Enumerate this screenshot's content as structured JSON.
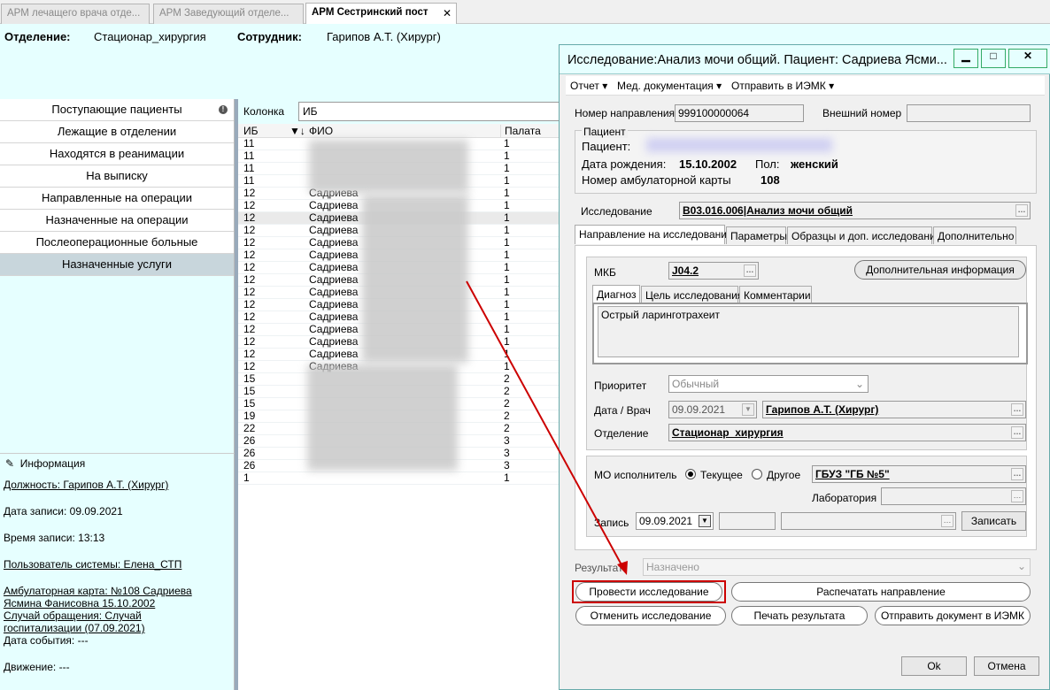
{
  "tabs": [
    {
      "label": "АРМ лечащего врача отде..."
    },
    {
      "label": "АРМ Заведующий отделе..."
    },
    {
      "label": "АРМ Сестринский пост",
      "close": "✕"
    }
  ],
  "header": {
    "dept_label": "Отделение:",
    "dept_value": "Стационар_хирургия",
    "emp_label": "Сотрудник:",
    "emp_value": "Гарипов А.Т. (Хирург)"
  },
  "nav": {
    "items": [
      {
        "label": "Поступающие пациенты"
      },
      {
        "label": "Лежащие в отделении"
      },
      {
        "label": "Находятся в реанимации"
      },
      {
        "label": "На выписку"
      },
      {
        "label": "Направленные на операции"
      },
      {
        "label": "Назначенные на операции"
      },
      {
        "label": "Послеоперационные больные"
      },
      {
        "label": "Назначенные услуги"
      }
    ],
    "info_badge": "!"
  },
  "info": {
    "title": "Информация",
    "position": "Должность: Гарипов А.Т. (Хирург)",
    "record_date": "Дата записи: 09.09.2021",
    "record_time": "Время записи: 13:13",
    "user": "Пользователь системы: Елена_СТП",
    "card_1": "Амбулаторная карта: №108 Садриева ",
    "card_2": "Ясмина Фанисовна 15.10.2002",
    "case_1": "Случай обращения: Случай ",
    "case_2": "госпитализации (07.09.2021)",
    "event_date": "Дата события: ---",
    "movement": "Движение: ---"
  },
  "filter": {
    "label": "Колонка",
    "value": "ИБ"
  },
  "table": {
    "headers": {
      "ib": "ИБ",
      "fio": "ФИО",
      "palata": "Палата"
    },
    "rows": [
      {
        "ib": "11",
        "fio": "",
        "palata": "1"
      },
      {
        "ib": "11",
        "fio": "",
        "palata": "1"
      },
      {
        "ib": "11",
        "fio": "",
        "palata": "1"
      },
      {
        "ib": "11",
        "fio": "",
        "palata": "1"
      },
      {
        "ib": "12",
        "fio": "Садриева",
        "palata": "1"
      },
      {
        "ib": "12",
        "fio": "Садриева",
        "palata": "1"
      },
      {
        "ib": "12",
        "fio": "Садриева",
        "palata": "1"
      },
      {
        "ib": "12",
        "fio": "Садриева",
        "palata": "1"
      },
      {
        "ib": "12",
        "fio": "Садриева",
        "palata": "1"
      },
      {
        "ib": "12",
        "fio": "Садриева",
        "palata": "1"
      },
      {
        "ib": "12",
        "fio": "Садриева",
        "palata": "1"
      },
      {
        "ib": "12",
        "fio": "Садриева",
        "palata": "1"
      },
      {
        "ib": "12",
        "fio": "Садриева",
        "palata": "1"
      },
      {
        "ib": "12",
        "fio": "Садриева",
        "palata": "1"
      },
      {
        "ib": "12",
        "fio": "Садриева",
        "palata": "1"
      },
      {
        "ib": "12",
        "fio": "Садриева",
        "palata": "1"
      },
      {
        "ib": "12",
        "fio": "Садриева",
        "palata": "1"
      },
      {
        "ib": "12",
        "fio": "Садриева",
        "palata": "1"
      },
      {
        "ib": "12",
        "fio": "Садриева",
        "palata": "1"
      },
      {
        "ib": "15",
        "fio": "",
        "palata": "2"
      },
      {
        "ib": "15",
        "fio": "",
        "palata": "2"
      },
      {
        "ib": "15",
        "fio": "",
        "palata": "2"
      },
      {
        "ib": "19",
        "fio": "",
        "palata": "2"
      },
      {
        "ib": "22",
        "fio": "",
        "palata": "2"
      },
      {
        "ib": "26",
        "fio": "",
        "palata": "3"
      },
      {
        "ib": "26",
        "fio": "",
        "palata": "3"
      },
      {
        "ib": "26",
        "fio": "",
        "palata": "3"
      },
      {
        "ib": "1",
        "fio": "",
        "palata": "1"
      }
    ]
  },
  "dialog": {
    "title": "Исследование:Анализ мочи общий. Пациент: Садриева Ясми...",
    "min": "▁",
    "max": "□",
    "close": "✕",
    "menu": {
      "report": "Отчет ▾",
      "docs": "Мед. документация ▾",
      "send": "Отправить в ИЭМК ▾"
    },
    "referral_label": "Номер направления",
    "referral_value": "999100000064",
    "external_label": "Внешний номер",
    "external_value": "",
    "patient_group": "Пациент",
    "patient_label": "Пациент:",
    "dob_label": "Дата рождения:",
    "dob_value": "15.10.2002",
    "sex_label": "Пол:",
    "sex_value": "женский",
    "card_label": "Номер амбулаторной карты",
    "card_value": "108",
    "study_label": "Исследование",
    "study_value": "B03.016.006|Анализ мочи общий",
    "tabs": [
      "Направление на исследование",
      "Параметры",
      "Образцы и доп. исследования",
      "Дополнительно"
    ],
    "mkb_label": "МКБ",
    "mkb_value": "J04.2",
    "extra_info_btn": "Дополнительная информация",
    "subtabs": [
      "Диагноз",
      "Цель исследования",
      "Комментарии"
    ],
    "diagnosis": "Острый ларинготрахеит",
    "priority_label": "Приоритет",
    "priority_value": "Обычный",
    "date_doc_label": "Дата / Врач",
    "date_value": "09.09.2021",
    "doctor_value": "Гарипов А.Т. (Хирург)",
    "dept_label": "Отделение",
    "dept_value": "Стационар_хирургия",
    "mo_label": "МО исполнитель",
    "radio_current": "Текущее",
    "radio_other": "Другое",
    "mo_value": "ГБУЗ \"ГБ №5\"",
    "lab_label": "Лаборатория",
    "lab_value": "",
    "record_label": "Запись",
    "record_date": "09.09.2021",
    "record_btn": "Записать",
    "result_label": "Результат",
    "result_value": "Назначено",
    "btn_conduct": "Провести исследование",
    "btn_print_ref": "Распечатать направление",
    "btn_cancel_study": "Отменить исследование",
    "btn_print_result": "Печать результата",
    "btn_send_doc": "Отправить документ в ИЭМК",
    "btn_ok": "Ok",
    "btn_cancel": "Отмена"
  },
  "colors": {
    "accent_bg": "#e6ffff",
    "highlight_box": "#cc0000",
    "arrow": "#cc0000"
  }
}
